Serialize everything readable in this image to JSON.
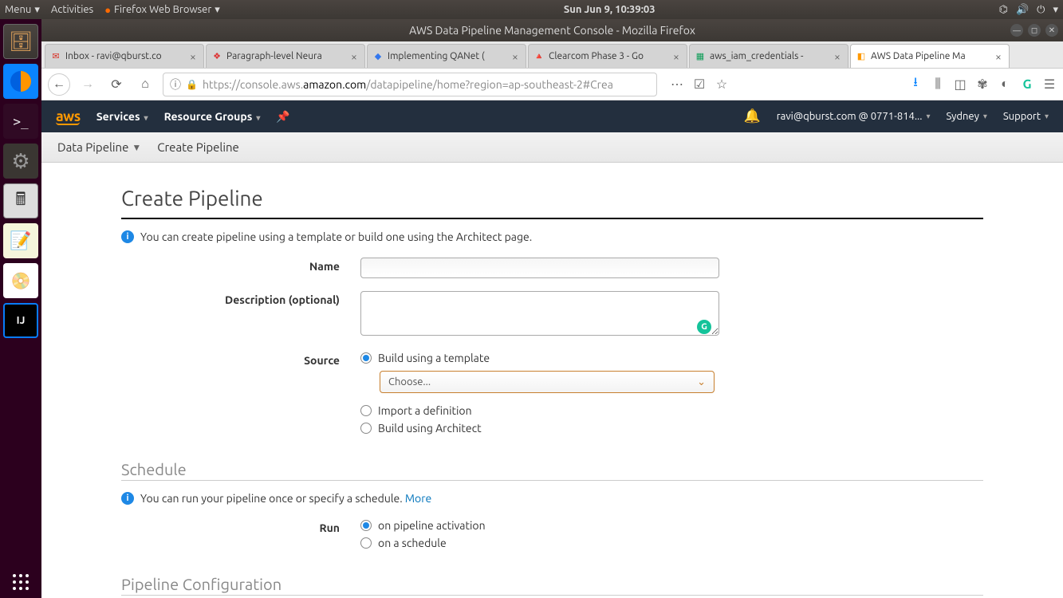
{
  "panel": {
    "menu": "Menu",
    "activities": "Activities",
    "app": "Firefox Web Browser",
    "clock": "Sun Jun  9, 10:39:03"
  },
  "firefox": {
    "windowTitle": "AWS Data Pipeline Management Console - Mozilla Firefox",
    "tabs": [
      {
        "label": "Inbox - ravi@qburst.co"
      },
      {
        "label": "Paragraph-level Neura"
      },
      {
        "label": "Implementing QANet ("
      },
      {
        "label": "Clearcom Phase 3 - Go"
      },
      {
        "label": "aws_iam_credentials - "
      },
      {
        "label": "AWS Data Pipeline Ma"
      }
    ],
    "url": {
      "pre": "https://console.aws.",
      "domain": "amazon.com",
      "post": "/datapipeline/home?region=ap-southeast-2#Crea"
    }
  },
  "aws": {
    "navServices": "Services",
    "navResourceGroups": "Resource Groups",
    "user": "ravi@qburst.com @ 0771-814...",
    "region": "Sydney",
    "support": "Support",
    "subnav": {
      "product": "Data Pipeline",
      "page": "Create Pipeline"
    },
    "page": {
      "title": "Create Pipeline",
      "intro": "You can create pipeline using a template or build one using the Architect page.",
      "nameLabel": "Name",
      "descLabel": "Description (optional)",
      "sourceLabel": "Source",
      "sourceOptions": {
        "template": "Build using a template",
        "import": "Import a definition",
        "architect": "Build using Architect"
      },
      "templatePlaceholder": "Choose...",
      "schedule": {
        "heading": "Schedule",
        "intro": "You can run your pipeline once or specify a schedule. ",
        "more": "More",
        "runLabel": "Run",
        "options": {
          "activation": "on pipeline activation",
          "schedule": "on a schedule"
        }
      },
      "configHeading": "Pipeline Configuration"
    }
  }
}
